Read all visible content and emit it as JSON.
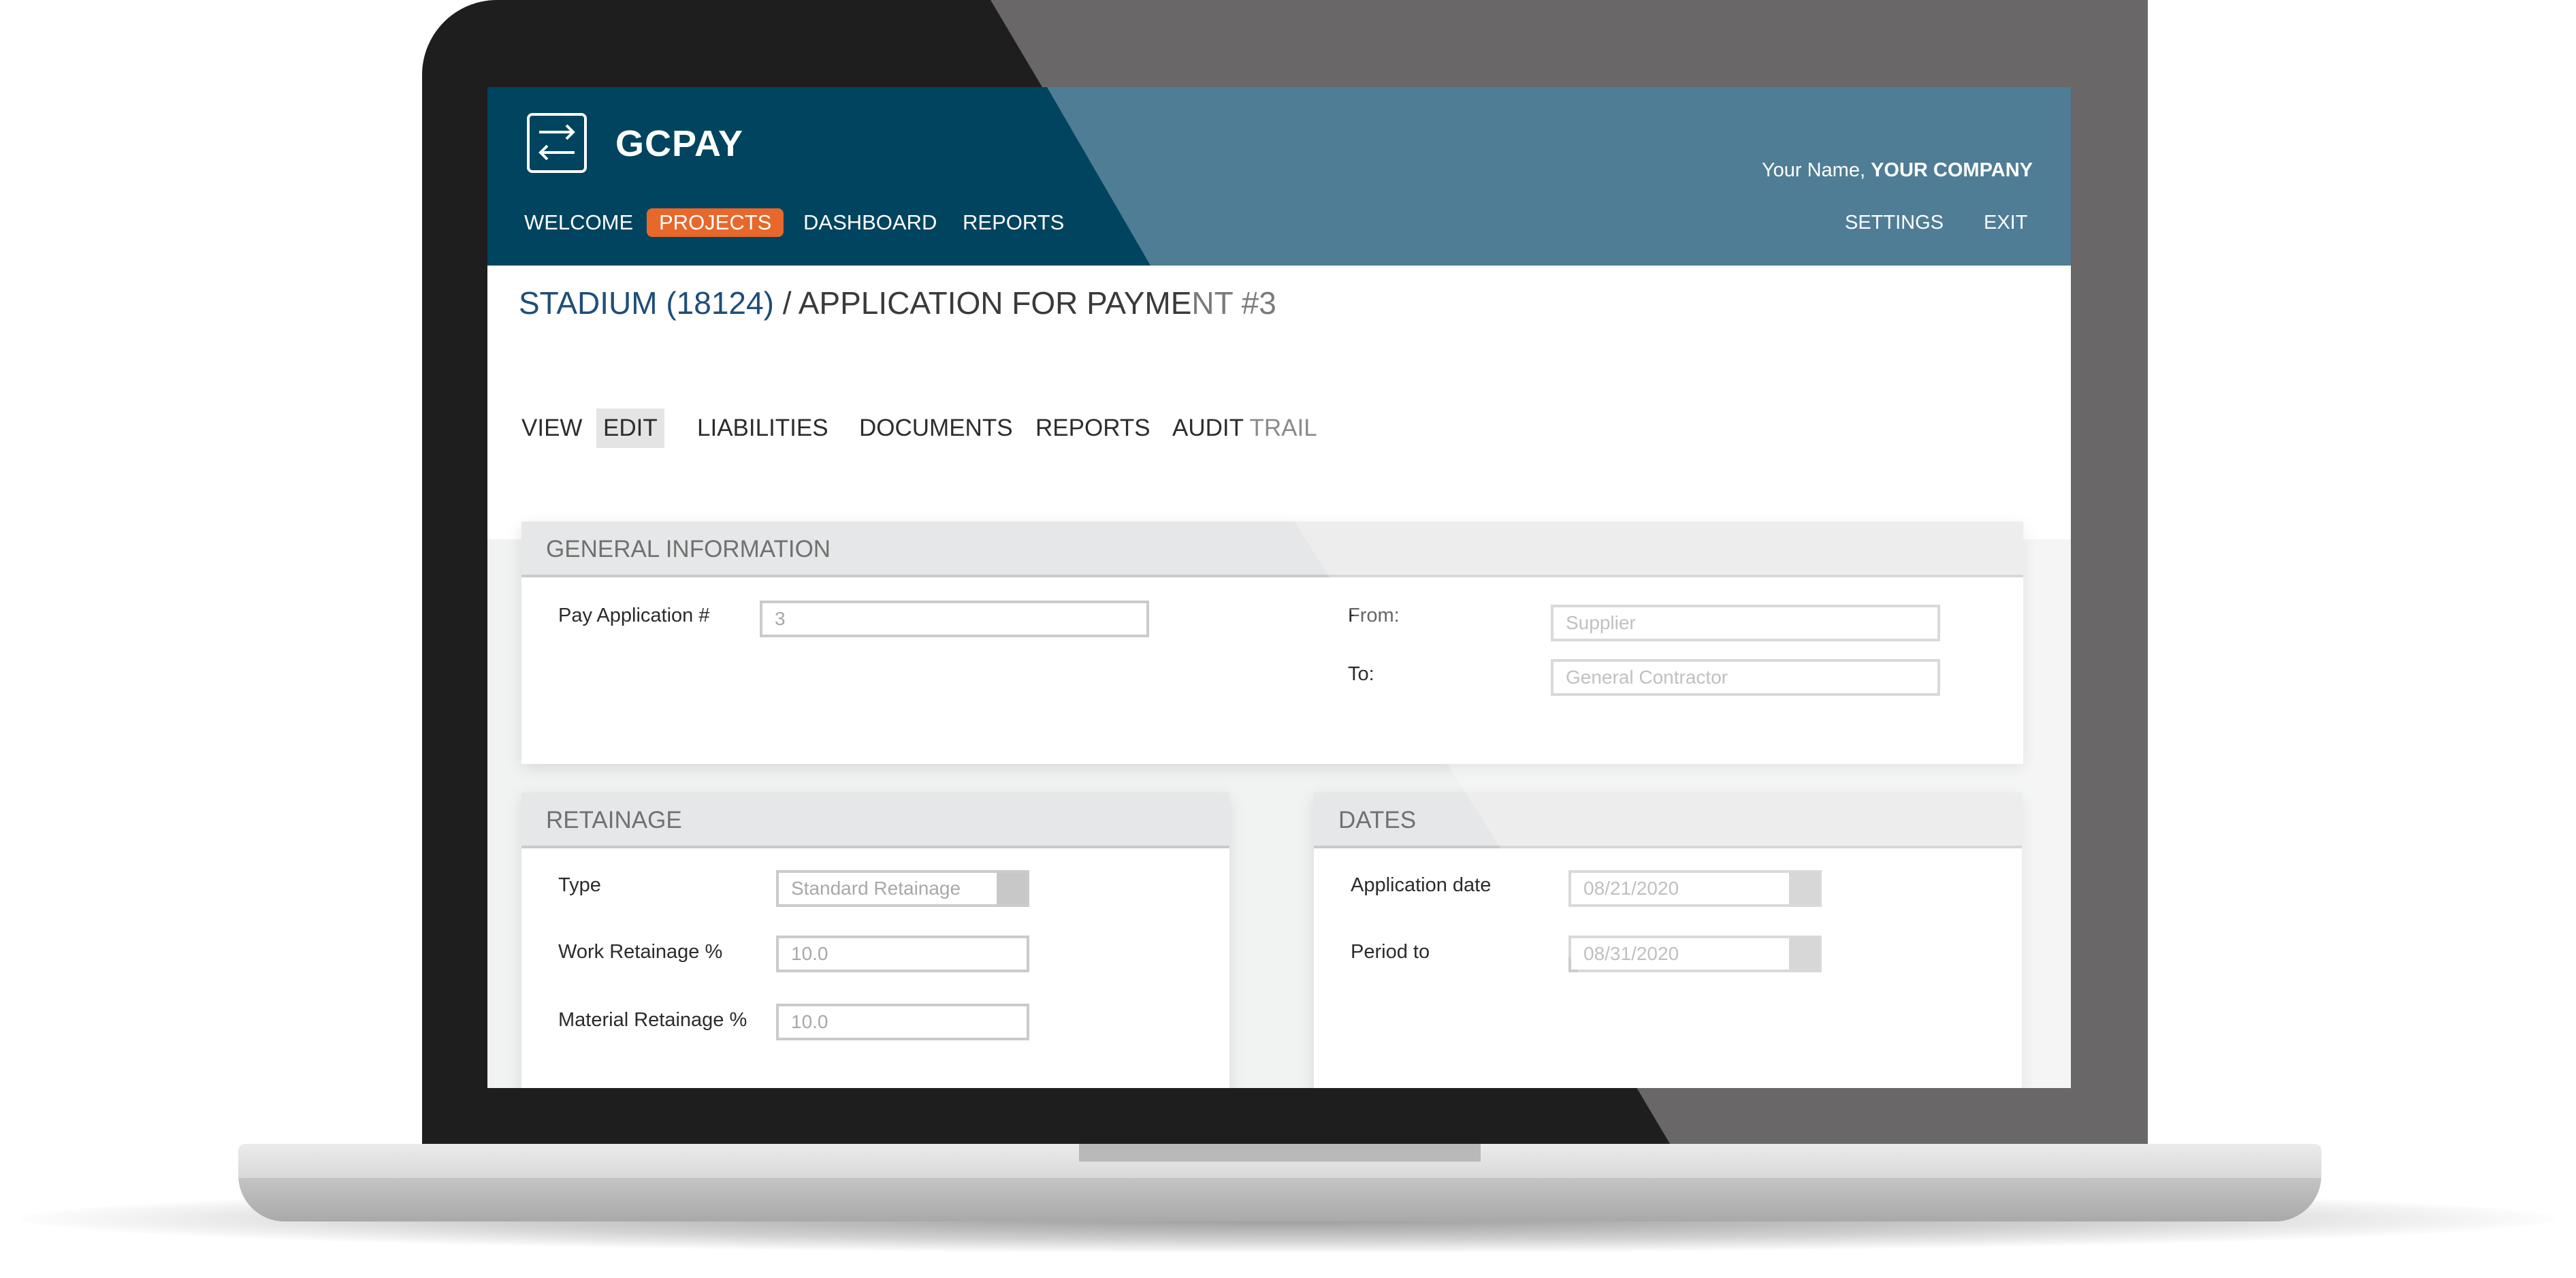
{
  "app": {
    "name": "GCPAY"
  },
  "nav": {
    "items": [
      "WELCOME",
      "PROJECTS",
      "DASHBOARD",
      "REPORTS"
    ],
    "active": "PROJECTS"
  },
  "user": {
    "name_prefix": "Your Name, ",
    "company": "YOUR COMPANY"
  },
  "right_nav": {
    "settings": "SETTINGS",
    "exit": "EXIT"
  },
  "breadcrumb": {
    "project": "STADIUM (18124)",
    "separator": " / ",
    "page_main": "APPLICATION FOR PAYME",
    "page_faded": "NT #3"
  },
  "tabs": {
    "view": "VIEW",
    "edit": "EDIT",
    "liabilities": "LIABILITIES",
    "documents": "DOCUMENTS",
    "reports": "REPORTS",
    "audit_main": "AUDIT ",
    "audit_faded": "TRAIL",
    "active": "EDIT"
  },
  "general_information": {
    "title": "GENERAL INFORMATION",
    "pay_application_label": "Pay Application #",
    "pay_application_value": "3",
    "from_label": "From:",
    "from_value": "Supplier",
    "to_label": "To:",
    "to_value": "General Contractor"
  },
  "retainage": {
    "title": "RETAINAGE",
    "type_label": "Type",
    "type_value": "Standard Retainage",
    "work_label": "Work Retainage %",
    "work_value": "10.0",
    "material_label": "Material Retainage %",
    "material_value": "10.0"
  },
  "dates": {
    "title": "DATES",
    "application_date_label": "Application date",
    "application_date_value": "08/21/2020",
    "period_to_label": "Period to",
    "period_to_value": "08/31/2020"
  },
  "colors": {
    "header_dark": "#00445f",
    "header_light": "#4f7d95",
    "accent_orange": "#e8672a",
    "project_link": "#1f4e79"
  },
  "icons": {
    "logo": "transfer-arrows-icon"
  }
}
